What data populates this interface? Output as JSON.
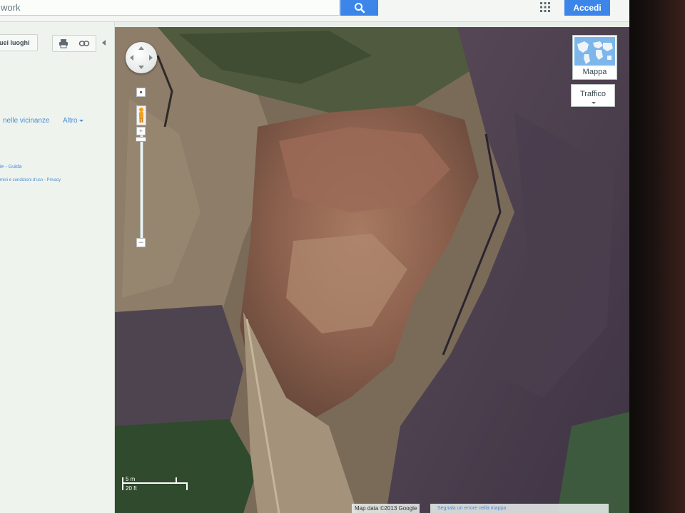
{
  "search": {
    "value": "work",
    "button_icon": "search-icon"
  },
  "header": {
    "apps_icon": "apps-grid-icon",
    "signin_label": "Accedi"
  },
  "panel": {
    "my_places_label": "uei luoghi",
    "print_icon": "print-icon",
    "link_icon": "link-icon",
    "nearby_label": "nelle vicinanze",
    "more_label": "Altro",
    "help_label": "ie - Guida",
    "terms_label": "mini e condizioni d'uso - Privacy"
  },
  "map": {
    "map_type_label": "Mappa",
    "traffic_label": "Traffico",
    "scale_metric": "5 m",
    "scale_imperial": "20 ft",
    "attribution": "Map data ©2013 Google",
    "report_text": "Segnala un errore nella mappa",
    "colors": {
      "accent": "#3b86e8",
      "link": "#4a8fd6"
    }
  }
}
